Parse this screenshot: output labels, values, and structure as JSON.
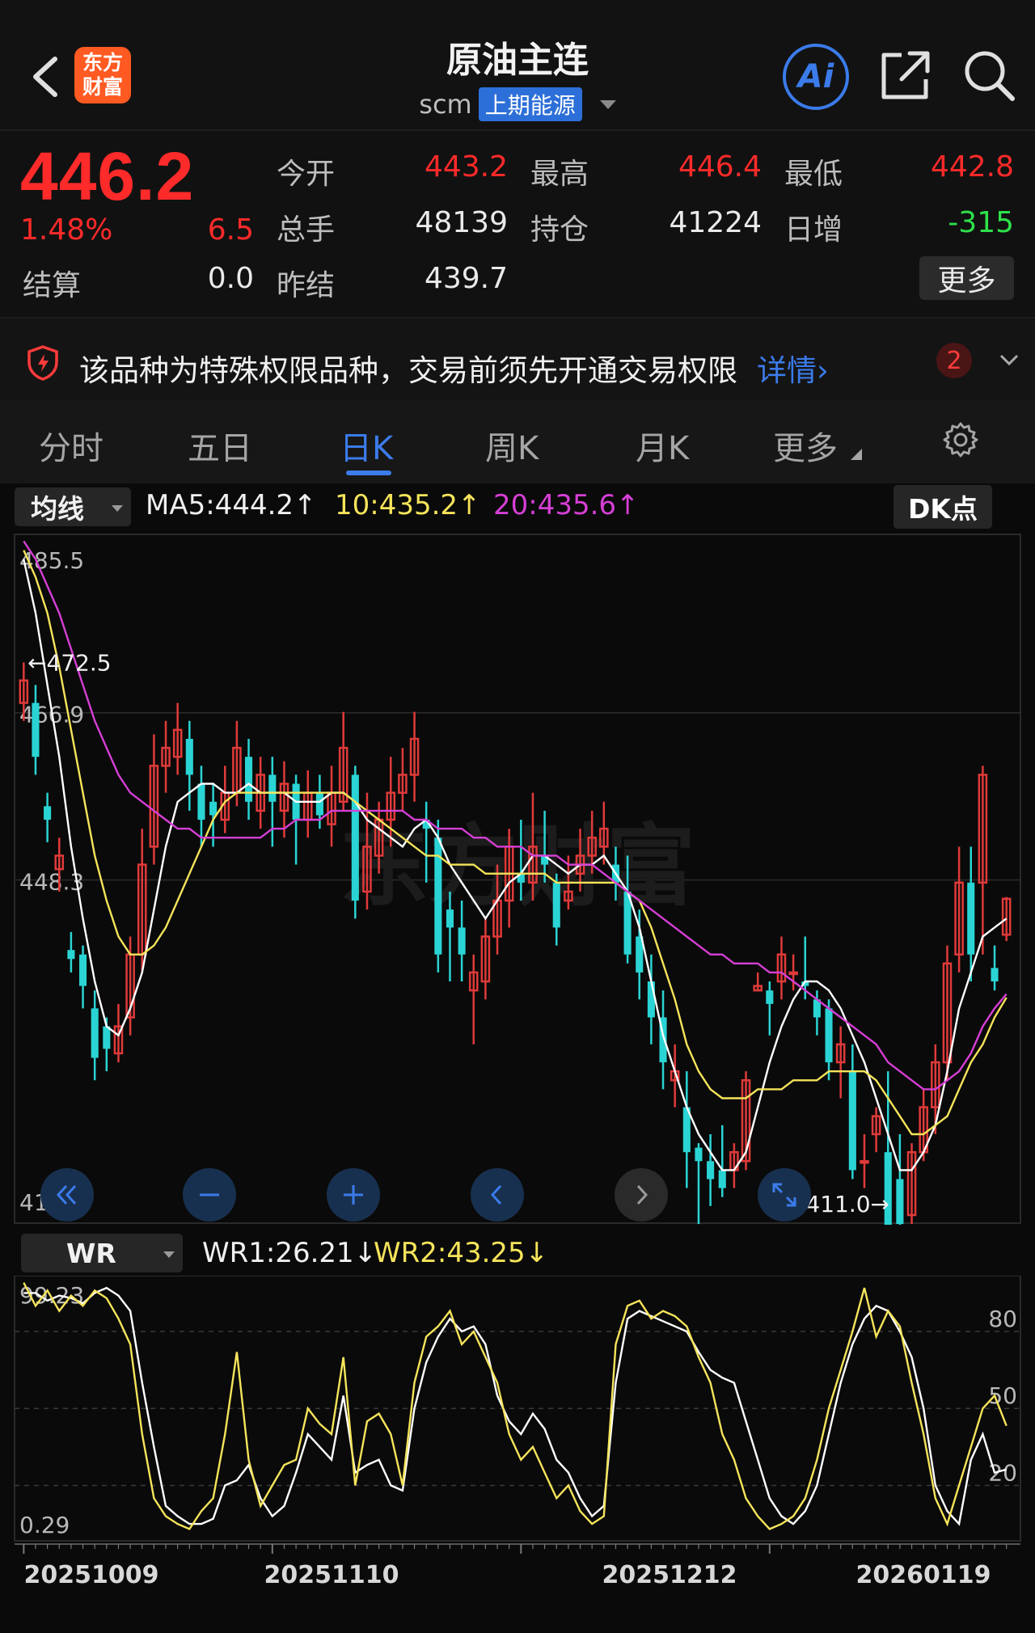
{
  "header": {
    "title": "原油主连",
    "code": "scm",
    "exchange": "上期能源",
    "logo_line1": "东方",
    "logo_line2": "财富",
    "ai_label": "Ai"
  },
  "quote": {
    "price": "446.2",
    "change_pct": "1.48%",
    "change": "6.5",
    "settle_label": "结算",
    "settle": "0.0",
    "open_label": "今开",
    "open": "443.2",
    "high_label": "最高",
    "high": "446.4",
    "low_label": "最低",
    "low": "442.8",
    "volume_label": "总手",
    "volume": "48139",
    "oi_label": "持仓",
    "oi": "41224",
    "daily_inc_label": "日增",
    "daily_inc": "-315",
    "prev_settle_label": "昨结",
    "prev_settle": "439.7",
    "more_label": "更多"
  },
  "notice": {
    "text": "该品种为特殊权限品种，交易前须先开通交易权限",
    "link": "详情›",
    "badge": "2"
  },
  "tabs": [
    {
      "label": "分时"
    },
    {
      "label": "五日"
    },
    {
      "label": "日K"
    },
    {
      "label": "周K"
    },
    {
      "label": "月K"
    },
    {
      "label": "更多"
    }
  ],
  "indicators": {
    "main_select": "均线",
    "ma5": "MA5:444.2↑",
    "ma10": "10:435.2↑",
    "ma20": "20:435.6↑",
    "dk_label": "DK点",
    "sub_select": "WR",
    "wr1": "WR1:26.21↓",
    "wr2": "WR2:43.25↓"
  },
  "colors": {
    "up": "#e03a3a",
    "down": "#2ad4d4",
    "ma5": "#ffffff",
    "ma10": "#f5e45a",
    "ma20": "#d63fd6",
    "wr1": "#ffffff",
    "wr2": "#f5e45a",
    "accent": "#3b7bea"
  },
  "chart_data": [
    {
      "type": "candlestick",
      "y_labels": [
        "485.5",
        "466.9",
        "448.3",
        "411.0"
      ],
      "ylim": [
        411.0,
        485.5
      ],
      "annotations": {
        "max_label": "←472.5",
        "min_label": "411.0→"
      },
      "x_tick_labels": [
        "20251009",
        "20251110",
        "20251212",
        "20260119"
      ],
      "candles": [
        [
          468.0,
          470.5,
          466.0,
          472.5
        ],
        [
          468.0,
          462.0,
          460.0,
          470.0
        ],
        [
          456.5,
          455.0,
          452.5,
          458.0
        ],
        [
          449.5,
          451.0,
          447.0,
          453.0
        ],
        [
          440.5,
          439.5,
          438.0,
          442.5
        ],
        [
          440.0,
          436.5,
          434.0,
          441.0
        ],
        [
          434.0,
          428.5,
          426.0,
          436.0
        ],
        [
          432.0,
          429.5,
          427.0,
          433.0
        ],
        [
          429.0,
          432.0,
          428.0,
          434.5
        ],
        [
          433.0,
          440.0,
          431.0,
          442.0
        ],
        [
          440.0,
          450.0,
          438.0,
          454.0
        ],
        [
          452.0,
          461.0,
          450.0,
          464.5
        ],
        [
          461.0,
          463.0,
          458.0,
          466.0
        ],
        [
          462.0,
          465.0,
          460.0,
          468.0
        ],
        [
          464.0,
          460.0,
          456.0,
          466.0
        ],
        [
          459.0,
          455.0,
          452.0,
          461.0
        ],
        [
          457.0,
          455.5,
          452.0,
          459.0
        ],
        [
          455.0,
          458.0,
          453.5,
          461.0
        ],
        [
          458.0,
          463.0,
          456.5,
          466.0
        ],
        [
          462.0,
          457.0,
          455.0,
          464.0
        ],
        [
          456.0,
          460.0,
          454.0,
          462.0
        ],
        [
          460.0,
          457.0,
          452.0,
          462.0
        ],
        [
          456.0,
          459.0,
          453.0,
          461.5
        ],
        [
          459.0,
          455.0,
          450.0,
          460.0
        ],
        [
          455.0,
          458.0,
          453.0,
          460.5
        ],
        [
          458.0,
          455.5,
          454.0,
          460.0
        ],
        [
          454.5,
          458.0,
          452.0,
          461.0
        ],
        [
          457.0,
          463.0,
          456.0,
          467.0
        ],
        [
          460.0,
          446.0,
          444.0,
          461.0
        ],
        [
          447.0,
          452.0,
          445.0,
          458.0
        ],
        [
          451.0,
          455.0,
          449.0,
          457.0
        ],
        [
          455.0,
          458.0,
          452.0,
          462.0
        ],
        [
          458.0,
          460.0,
          456.0,
          463.0
        ],
        [
          460.0,
          464.0,
          457.0,
          467.0
        ],
        [
          455.0,
          454.0,
          448.0,
          457.0
        ],
        [
          453.0,
          440.0,
          438.0,
          455.0
        ],
        [
          445.0,
          443.0,
          437.0,
          447.0
        ],
        [
          443.0,
          440.0,
          437.0,
          446.0
        ],
        [
          436.0,
          438.0,
          430.0,
          440.0
        ],
        [
          437.0,
          442.0,
          435.0,
          444.0
        ],
        [
          442.0,
          446.0,
          440.0,
          450.0
        ],
        [
          446.0,
          452.0,
          443.0,
          454.0
        ],
        [
          449.0,
          448.0,
          446.0,
          455.0
        ],
        [
          448.0,
          452.0,
          446.0,
          458.0
        ],
        [
          451.0,
          450.0,
          448.0,
          456.0
        ],
        [
          448.0,
          443.0,
          441.0,
          449.0
        ],
        [
          446.0,
          447.0,
          445.0,
          451.0
        ],
        [
          449.0,
          451.0,
          447.0,
          454.0
        ],
        [
          451.0,
          453.0,
          449.0,
          456.0
        ],
        [
          452.0,
          454.0,
          450.0,
          457.0
        ],
        [
          450.0,
          448.0,
          446.0,
          452.0
        ],
        [
          447.0,
          440.0,
          439.0,
          451.0
        ],
        [
          442.0,
          438.0,
          435.0,
          445.0
        ],
        [
          437.0,
          433.0,
          430.0,
          440.0
        ],
        [
          433.0,
          428.0,
          425.0,
          436.0
        ],
        [
          426.0,
          427.0,
          423.0,
          430.0
        ],
        [
          423.0,
          418.0,
          414.0,
          427.0
        ],
        [
          418.5,
          417.0,
          410.0,
          419.0
        ],
        [
          417.0,
          415.0,
          412.0,
          420.0
        ],
        [
          416.0,
          414.0,
          413.0,
          421.0
        ],
        [
          416.0,
          418.0,
          414.0,
          419.0
        ],
        [
          417.0,
          426.0,
          416.0,
          427.0
        ],
        [
          436.0,
          436.5,
          436.0,
          438.0
        ],
        [
          436.0,
          434.5,
          431.0,
          437.0
        ],
        [
          437.0,
          440.0,
          435.0,
          442.0
        ],
        [
          438.0,
          438.0,
          436.0,
          440.0
        ],
        [
          437.0,
          436.5,
          435.0,
          442.0
        ],
        [
          435.0,
          433.0,
          431.0,
          436.0
        ],
        [
          434.0,
          428.0,
          426.0,
          435.0
        ],
        [
          428.0,
          430.0,
          424.0,
          432.0
        ],
        [
          427.0,
          416.0,
          415.0,
          430.0
        ],
        [
          417.0,
          417.0,
          414.0,
          420.0
        ],
        [
          420.0,
          422.0,
          418.0,
          423.0
        ],
        [
          418.0,
          408.0,
          406.0,
          427.0
        ],
        [
          415.0,
          410.0,
          409.0,
          420.0
        ],
        [
          411.0,
          418.0,
          410.0,
          419.0
        ],
        [
          418.0,
          423.0,
          417.0,
          425.0
        ],
        [
          423.0,
          428.0,
          420.0,
          430.0
        ],
        [
          428.0,
          439.0,
          426.0,
          441.0
        ],
        [
          440.0,
          448.0,
          438.0,
          452.0
        ],
        [
          448.0,
          440.0,
          437.0,
          452.0
        ],
        [
          448.0,
          460.0,
          440.0,
          461.0
        ],
        [
          438.5,
          437.0,
          436.0,
          441.0
        ],
        [
          442.2,
          446.2,
          441.5,
          446.4
        ]
      ],
      "series": [
        {
          "name": "MA5",
          "values": [
            484,
            478,
            470,
            462,
            452,
            444,
            437,
            432,
            431,
            434,
            438,
            445,
            452,
            457,
            458,
            459,
            459,
            458,
            458,
            459,
            458,
            458,
            458,
            457,
            457,
            457,
            458,
            458,
            457,
            455,
            454,
            453,
            452,
            454,
            455,
            453,
            450,
            448,
            446,
            444,
            446,
            448,
            449,
            451,
            451,
            450,
            449,
            450,
            450,
            451,
            449,
            447,
            443,
            437,
            431,
            427,
            423,
            420,
            418,
            416,
            416,
            418,
            423,
            428,
            432,
            435,
            437,
            437,
            436,
            434,
            431,
            428,
            424,
            420,
            416,
            416,
            418,
            421,
            427,
            434,
            438,
            442,
            443,
            444
          ]
        },
        {
          "name": "10",
          "values": [
            485,
            482,
            478,
            472,
            465,
            458,
            451,
            446,
            442,
            440,
            440,
            441,
            443,
            446,
            449,
            452,
            455,
            457,
            458,
            458,
            458,
            458,
            458,
            458,
            458,
            458,
            458,
            458,
            457,
            456,
            455,
            454,
            453,
            452,
            451,
            451,
            450,
            450,
            450,
            449,
            449,
            449,
            449,
            449,
            449,
            448,
            448,
            448,
            448,
            448,
            448,
            447,
            446,
            443,
            439,
            435,
            430,
            427,
            425,
            424,
            424,
            424,
            425,
            425,
            425,
            426,
            426,
            426,
            427,
            427,
            427,
            427,
            426,
            424,
            422,
            420,
            420,
            421,
            422,
            425,
            428,
            430,
            433,
            435.2
          ]
        },
        {
          "name": "20",
          "values": [
            486,
            484,
            481,
            478,
            474,
            470,
            466,
            463,
            460,
            458,
            457,
            456,
            455,
            454,
            454,
            453,
            453,
            453,
            453,
            453,
            453,
            454,
            454,
            455,
            455,
            455,
            456,
            456,
            456,
            456,
            456,
            456,
            456,
            455,
            455,
            454,
            454,
            454,
            453,
            453,
            452,
            452,
            452,
            451,
            451,
            451,
            450,
            450,
            450,
            449,
            448,
            447,
            446,
            445,
            444,
            443,
            442,
            441,
            440,
            440,
            439,
            439,
            439,
            438,
            438,
            437,
            436,
            435,
            434,
            433,
            432,
            431,
            430,
            428,
            427,
            426,
            425,
            425,
            426,
            427,
            429,
            432,
            434,
            435.6
          ]
        }
      ]
    },
    {
      "type": "line",
      "y_labels": [
        "99.23",
        "80",
        "50",
        "20",
        "0.29"
      ],
      "ylim": [
        0.29,
        99.23
      ],
      "series": [
        {
          "name": "WR1",
          "values": [
            95,
            95,
            92,
            94,
            93,
            91,
            95,
            97,
            94,
            88,
            60,
            35,
            12,
            8,
            5,
            5,
            7,
            20,
            22,
            28,
            15,
            8,
            12,
            25,
            40,
            35,
            30,
            55,
            25,
            28,
            30,
            20,
            18,
            50,
            68,
            78,
            85,
            80,
            82,
            75,
            55,
            45,
            40,
            48,
            42,
            30,
            25,
            15,
            8,
            12,
            60,
            85,
            88,
            86,
            84,
            82,
            80,
            72,
            65,
            62,
            60,
            45,
            30,
            15,
            8,
            5,
            10,
            20,
            40,
            60,
            75,
            85,
            90,
            88,
            80,
            70,
            50,
            20,
            10,
            5,
            30,
            40,
            25,
            26.21
          ]
        },
        {
          "name": "WR2",
          "values": [
            99,
            90,
            96,
            88,
            94,
            90,
            96,
            93,
            85,
            75,
            40,
            15,
            8,
            5,
            3,
            10,
            15,
            40,
            72,
            30,
            12,
            20,
            28,
            30,
            50,
            44,
            40,
            70,
            20,
            45,
            48,
            40,
            20,
            60,
            78,
            82,
            88,
            75,
            80,
            70,
            60,
            40,
            30,
            35,
            25,
            15,
            20,
            10,
            5,
            8,
            75,
            90,
            92,
            85,
            88,
            86,
            82,
            70,
            60,
            40,
            30,
            15,
            8,
            3,
            5,
            8,
            15,
            30,
            50,
            65,
            80,
            97,
            78,
            88,
            82,
            60,
            40,
            15,
            5,
            20,
            35,
            50,
            55,
            43.25
          ]
        }
      ]
    }
  ]
}
